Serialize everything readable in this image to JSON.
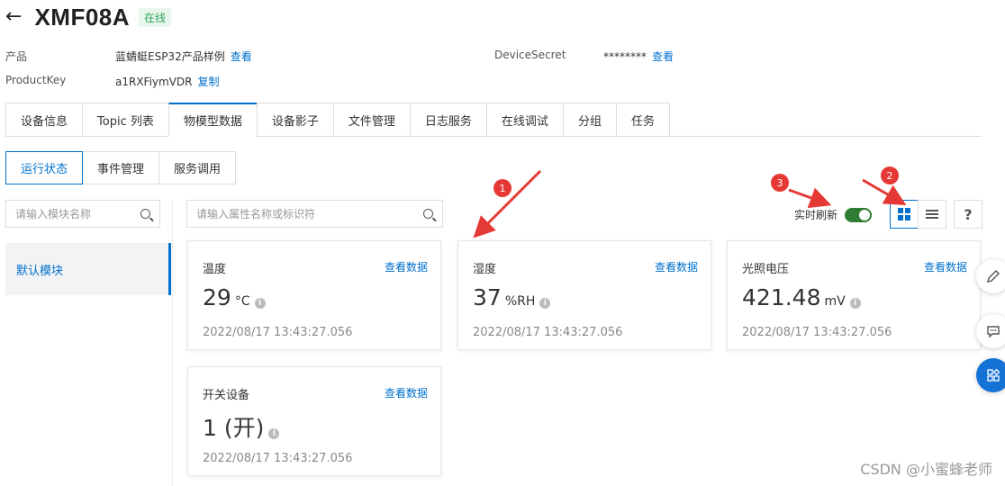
{
  "header": {
    "back_glyph": "←",
    "title": "XMF08A",
    "status": "在线"
  },
  "info": {
    "product_label": "产品",
    "product_value": "蓝蜻蜓ESP32产品样例",
    "product_link": "查看",
    "productkey_label": "ProductKey",
    "productkey_value": "a1RXFiymVDR",
    "productkey_link": "复制",
    "secret_label": "DeviceSecret",
    "secret_value": "********",
    "secret_link": "查看"
  },
  "tabs": [
    {
      "label": "设备信息"
    },
    {
      "label": "Topic 列表"
    },
    {
      "label": "物模型数据"
    },
    {
      "label": "设备影子"
    },
    {
      "label": "文件管理"
    },
    {
      "label": "日志服务"
    },
    {
      "label": "在线调试"
    },
    {
      "label": "分组"
    },
    {
      "label": "任务"
    }
  ],
  "subtabs": [
    {
      "label": "运行状态"
    },
    {
      "label": "事件管理"
    },
    {
      "label": "服务调用"
    }
  ],
  "module_search": {
    "placeholder": "请输入模块名称"
  },
  "prop_search": {
    "placeholder": "请输入属性名称或标识符"
  },
  "sidebar": {
    "default_module": "默认模块"
  },
  "refresh": {
    "label": "实时刷新",
    "enabled": true
  },
  "cards": [
    {
      "name": "温度",
      "view": "查看数据",
      "value": "29",
      "unit": "°C",
      "time": "2022/08/17 13:43:27.056"
    },
    {
      "name": "湿度",
      "view": "查看数据",
      "value": "37",
      "unit": "%RH",
      "time": "2022/08/17 13:43:27.056"
    },
    {
      "name": "光照电压",
      "view": "查看数据",
      "value": "421.48",
      "unit": "mV",
      "time": "2022/08/17 13:43:27.056"
    },
    {
      "name": "开关设备",
      "view": "查看数据",
      "value": "1 (开)",
      "unit": "",
      "time": "2022/08/17 13:43:27.056"
    }
  ],
  "annotations": [
    "1",
    "2",
    "3"
  ],
  "help_glyph": "?",
  "watermark": "CSDN @小蜜蜂老师",
  "colors": {
    "accent": "#0070cc",
    "online": "#2fa35a",
    "annotation": "#e53935",
    "toggle_on": "#2e7d32"
  }
}
